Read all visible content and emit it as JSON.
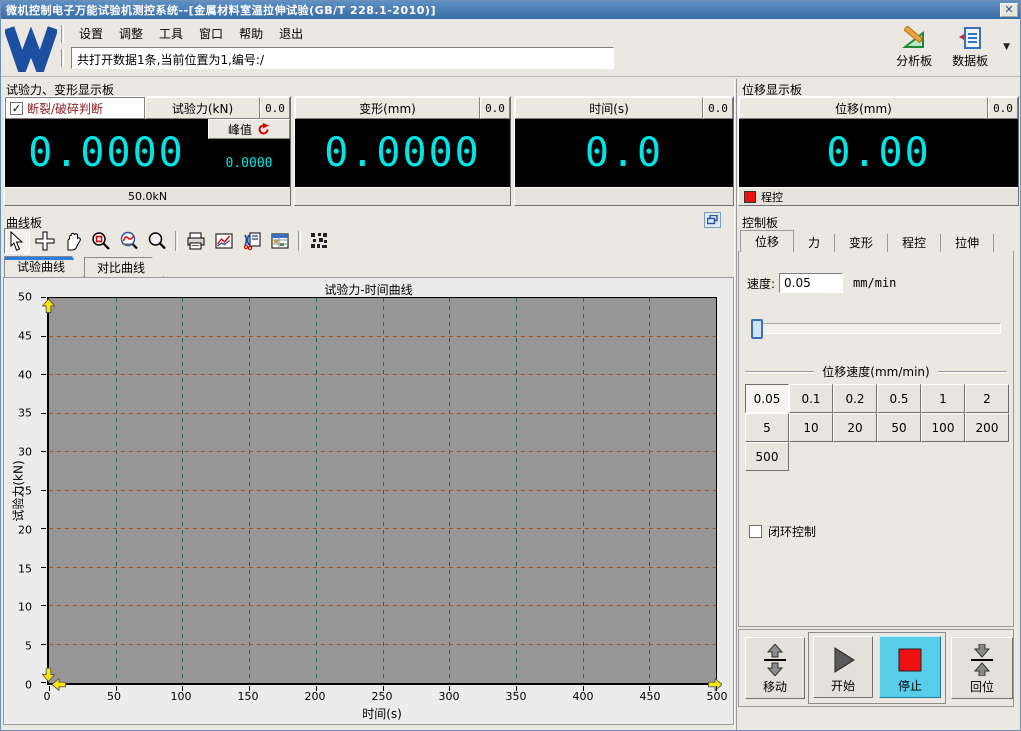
{
  "window": {
    "title": "微机控制电子万能试验机测控系统--[金属材料室温拉伸试验(GB/T 228.1-2010)]"
  },
  "menu": {
    "items": [
      "设置",
      "调整",
      "工具",
      "窗口",
      "帮助",
      "退出"
    ]
  },
  "header": {
    "status_text": "共打开数据1条,当前位置为1,编号:/",
    "analysis_label": "分析板",
    "data_label": "数据板"
  },
  "icons": {
    "dropdown": "▼",
    "check": "✓",
    "close": "✕"
  },
  "display_section": {
    "title": "试验力、变形显示板"
  },
  "force_panel": {
    "break_check_label": "断裂/破碎判断",
    "header": "试验力(kN)",
    "small_value": "0.0",
    "value": "0.0000",
    "peak_label": "峰值",
    "peak_value": "0.0000",
    "range": "50.0kN"
  },
  "deform_panel": {
    "header": "变形(mm)",
    "small_value": "0.0",
    "value": "0.0000"
  },
  "time_panel": {
    "header": "时间(s)",
    "small_value": "0.0",
    "value": "0.0"
  },
  "disp_section": {
    "title": "位移显示板"
  },
  "disp_panel": {
    "header": "位移(mm)",
    "small_value": "0.0",
    "value": "0.00",
    "mode_label": "程控"
  },
  "curve_panel": {
    "title": "曲线板",
    "tabs": [
      "试验曲线",
      "对比曲线"
    ]
  },
  "control_panel": {
    "title": "控制板",
    "tabs": [
      "位移",
      "力",
      "变形",
      "程控",
      "拉伸"
    ],
    "speed_label": "速度:",
    "speed_value": "0.05",
    "speed_unit": "mm/min",
    "group_label": "位移速度(mm/min)",
    "speed_buttons": [
      "0.05",
      "0.1",
      "0.2",
      "0.5",
      "1",
      "2",
      "5",
      "10",
      "20",
      "50",
      "100",
      "200",
      "500"
    ],
    "active_speed": "0.05",
    "loop_label": "闭环控制",
    "buttons": {
      "move": "移动",
      "start": "开始",
      "stop": "停止",
      "home": "回位"
    }
  },
  "chart_data": {
    "type": "line",
    "title": "试验力-时间曲线",
    "xlabel": "时间(s)",
    "ylabel": "试验力(kN)",
    "xlim": [
      0,
      500
    ],
    "xstep": 50,
    "ylim": [
      0,
      50
    ],
    "ystep": 5,
    "series": [],
    "grid": true,
    "legend": false,
    "plot_bg": "#969696",
    "hgrid_color": "#a4562b",
    "vgrid_color": "#2e5f55"
  },
  "colors": {
    "display_text": "#00e6e6",
    "stop_active_bg": "#58cdea",
    "alarm_red": "#ee1111",
    "titlebar_blue": "#3f72ad",
    "tab_accent_blue": "#2f7ce0",
    "break_label_color": "#8b2020",
    "logo_blue": "#1d4fa0"
  }
}
